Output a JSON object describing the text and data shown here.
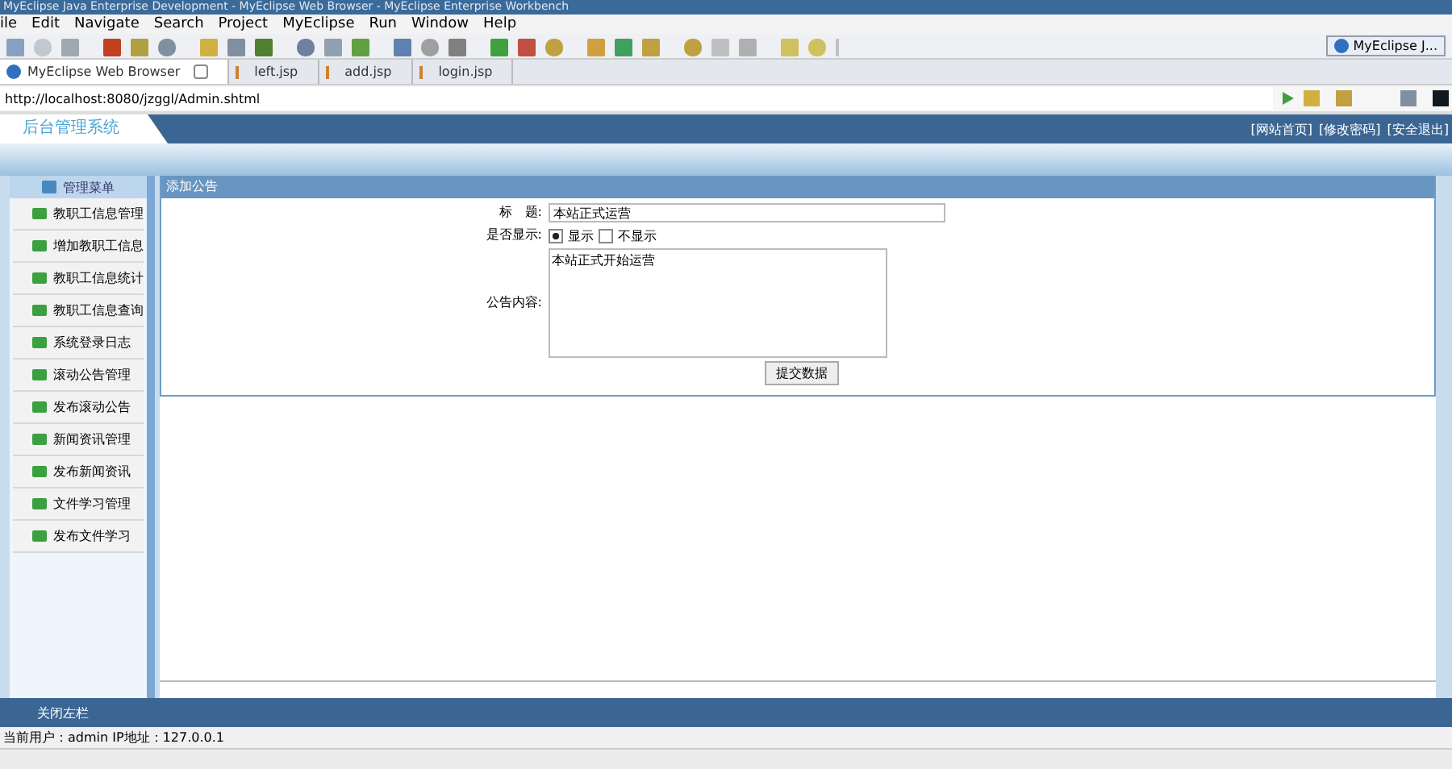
{
  "window": {
    "title": "MyEclipse Java Enterprise Development - MyEclipse Web Browser - MyEclipse Enterprise Workbench"
  },
  "menu": [
    "ile",
    "Edit",
    "Navigate",
    "Search",
    "Project",
    "MyEclipse",
    "Run",
    "Window",
    "Help"
  ],
  "perspective": {
    "label": "MyEclipse J..."
  },
  "editor_tabs": [
    {
      "label": "MyEclipse Web Browser",
      "selected": true,
      "kind": "browser"
    },
    {
      "label": "left.jsp",
      "selected": false,
      "kind": "jsp"
    },
    {
      "label": "add.jsp",
      "selected": false,
      "kind": "jsp"
    },
    {
      "label": "login.jsp",
      "selected": false,
      "kind": "jsp"
    }
  ],
  "address": {
    "value": "http://localhost:8080/jzggl/Admin.shtml"
  },
  "site": {
    "logo": "后台管理系统",
    "top_links": [
      "[网站首页]",
      "[修改密码]",
      "[安全退出]"
    ]
  },
  "sidebar": {
    "title": "管理菜单",
    "items": [
      "教职工信息管理",
      "增加教职工信息",
      "教职工信息统计",
      "教职工信息查询",
      "系统登录日志",
      "滚动公告管理",
      "发布滚动公告",
      "新闻资讯管理",
      "发布新闻资讯",
      "文件学习管理",
      "发布文件学习"
    ]
  },
  "panel": {
    "title": "添加公告",
    "form": {
      "title_label": "标　题:",
      "title_value": "本站正式运营",
      "show_label": "是否显示:",
      "show_options": [
        {
          "label": "显示",
          "selected": true
        },
        {
          "label": "不显示",
          "selected": false
        }
      ],
      "content_label": "公告内容:",
      "content_value": "本站正式开始运营",
      "submit": "提交数据"
    }
  },
  "footer": {
    "toggle": "关闭左栏"
  },
  "status_bar": {
    "text": "当前用户：admin  IP地址：127.0.0.1"
  }
}
